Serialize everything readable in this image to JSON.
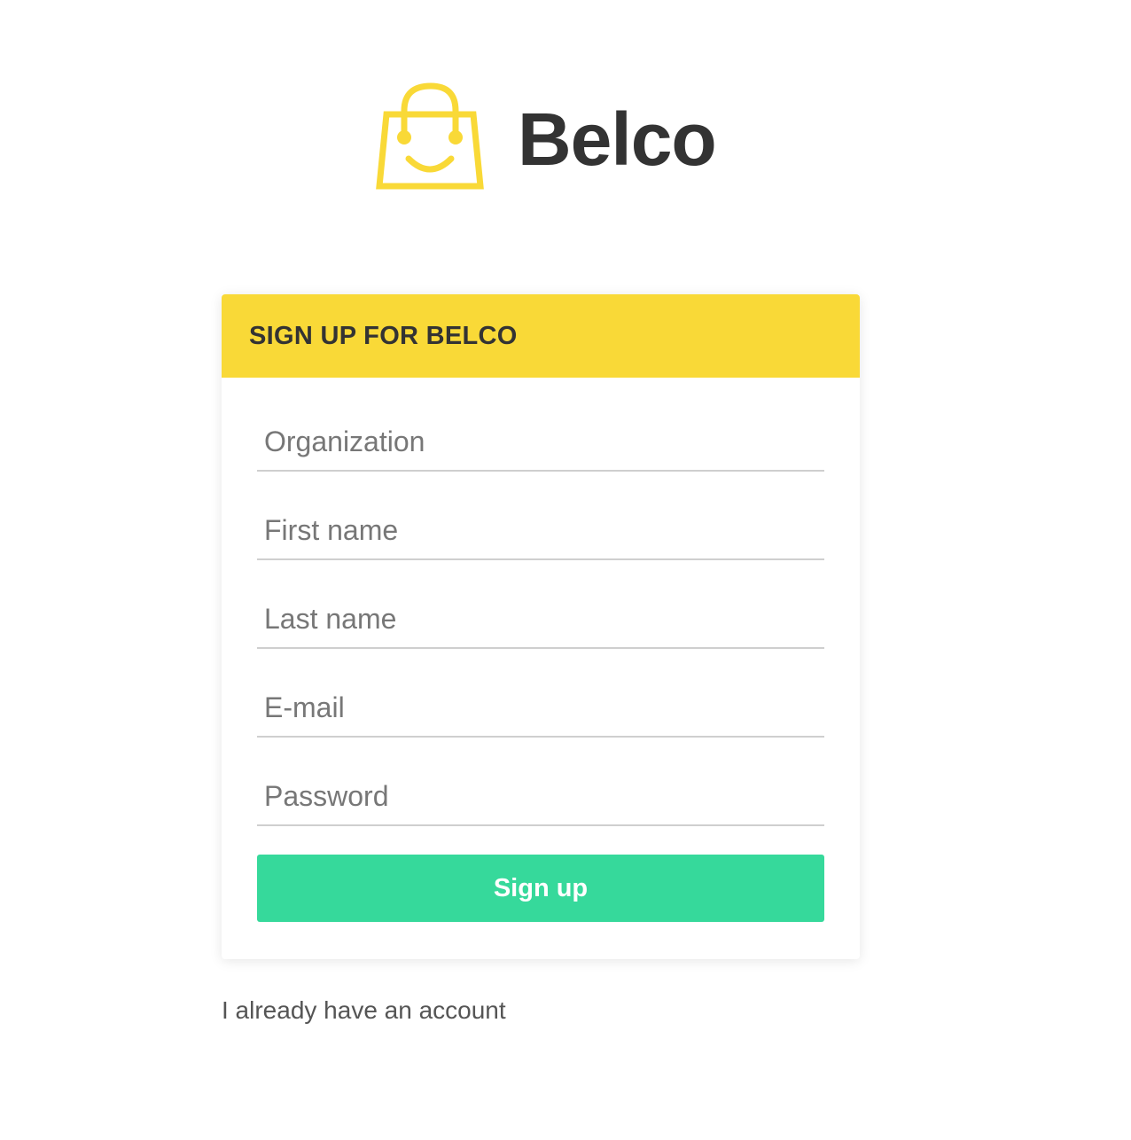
{
  "logo": {
    "text": "Belco",
    "icon": "shopping-bag-smile-icon",
    "accent_color": "#f9d937"
  },
  "card": {
    "title": "SIGN UP FOR BELCO",
    "header_color": "#f9d937"
  },
  "form": {
    "fields": [
      {
        "name": "organization",
        "placeholder": "Organization",
        "value": ""
      },
      {
        "name": "first_name",
        "placeholder": "First name",
        "value": ""
      },
      {
        "name": "last_name",
        "placeholder": "Last name",
        "value": ""
      },
      {
        "name": "email",
        "placeholder": "E-mail",
        "value": ""
      },
      {
        "name": "password",
        "placeholder": "Password",
        "value": ""
      }
    ],
    "submit_label": "Sign up",
    "submit_color": "#36d99b"
  },
  "footer": {
    "login_link": "I already have an account"
  }
}
